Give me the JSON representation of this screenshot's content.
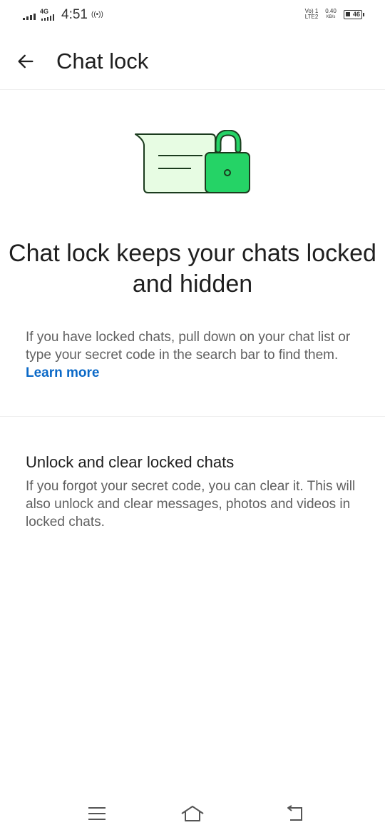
{
  "status_bar": {
    "network_type": "4G",
    "time": "4:51",
    "hotspot": "((•))",
    "volte_line1": "Vo) 1",
    "volte_line2": "LTE2",
    "speed_value": "0.40",
    "speed_unit": "KB/s",
    "battery": "46"
  },
  "header": {
    "title": "Chat lock"
  },
  "main": {
    "headline": "Chat lock keeps your chats locked and hidden",
    "description": "If you have locked chats, pull down on your chat list or type your secret code in the search bar to find them.",
    "learn_more": "Learn more"
  },
  "unlock_section": {
    "title": "Unlock and clear locked chats",
    "description": "If you forgot your secret code, you can clear it. This will also unlock and clear messages, photos and videos in locked chats."
  },
  "colors": {
    "accent_green": "#25d366",
    "light_green": "#e7fce3",
    "outline": "#1b3b1e",
    "link_blue": "#0b69c7"
  },
  "icons": {
    "back": "arrow-left-icon",
    "illustration": "chat-lock-illustration",
    "nav_menu": "menu-icon",
    "nav_home": "home-icon",
    "nav_back": "back-icon"
  }
}
